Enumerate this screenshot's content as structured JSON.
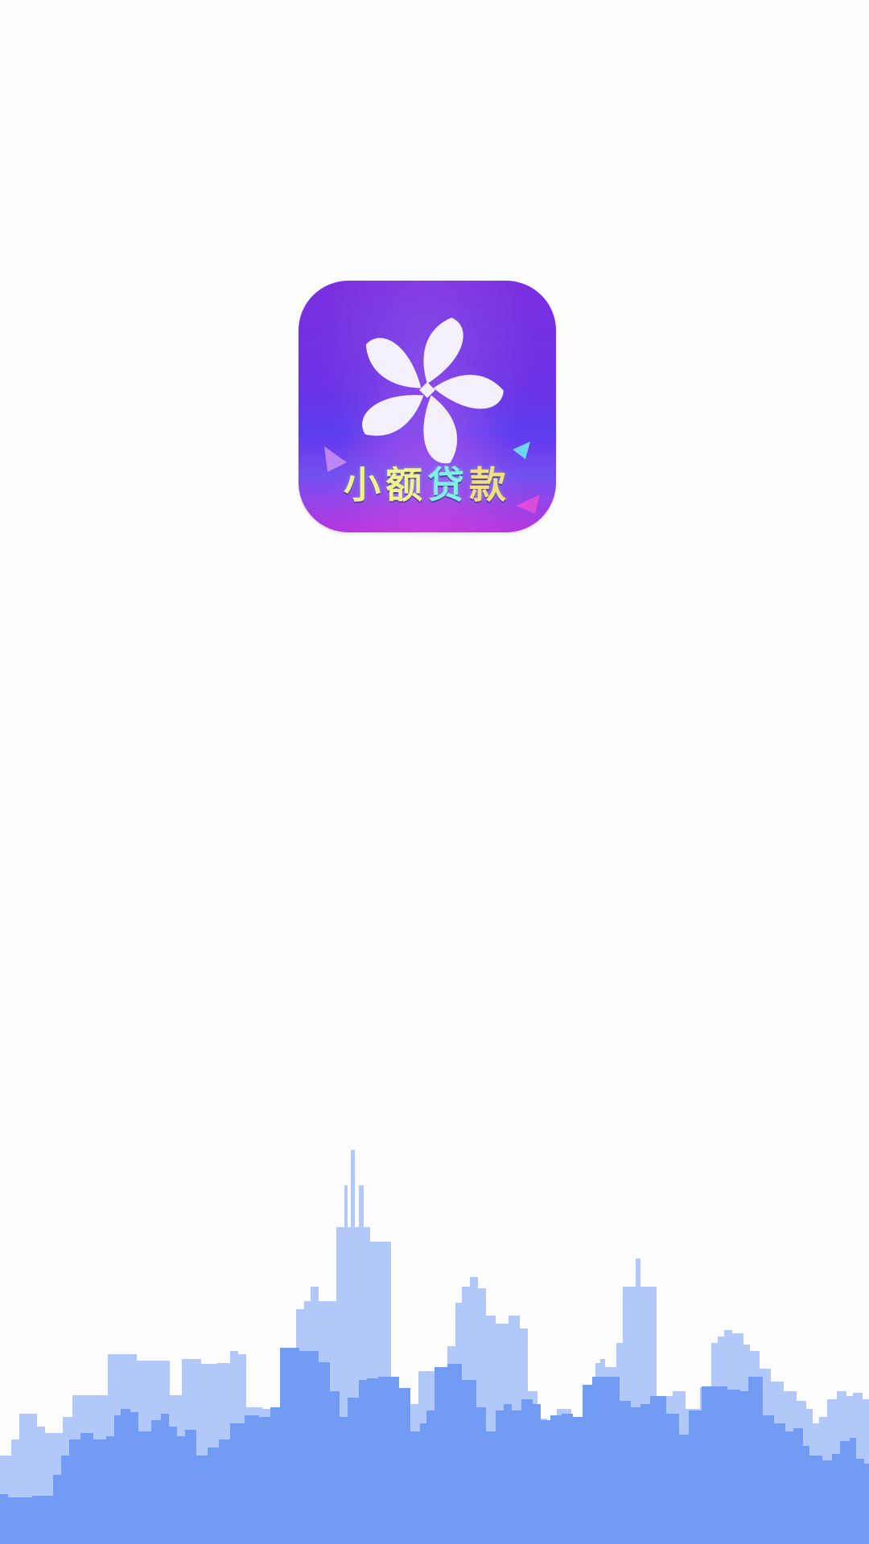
{
  "splash": {
    "app_icon": {
      "title": "小额贷款",
      "title_chars": [
        "小",
        "额",
        "贷",
        "款"
      ],
      "icon": "pinwheel-icon",
      "colors": {
        "bg_top": "#7b2fe0",
        "bg_bottom": "#c12fd8",
        "pinwheel": "#f3f0fb",
        "title_yellow": "#f1f48a",
        "title_cyan": "#7ff0e4"
      }
    },
    "background": {
      "color": "#fefefe",
      "illustration": "city-skyline-illustration",
      "colors": {
        "skyline_back": "#b1c8f8",
        "skyline_front": "#729bf3"
      }
    }
  }
}
